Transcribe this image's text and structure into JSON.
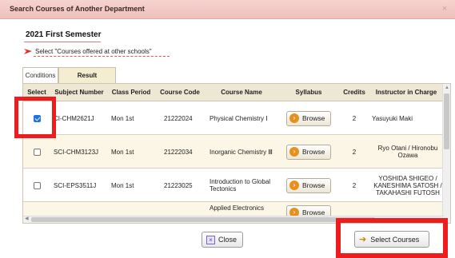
{
  "window": {
    "title": "Search Courses of Another Department",
    "close_glyph": "×"
  },
  "semester": "2021 First Semester",
  "instruction": "Select \"Courses offered at other schools\"",
  "tabs": [
    {
      "label": "Conditions"
    },
    {
      "label": "Result",
      "active": true
    }
  ],
  "table": {
    "headers": [
      "Select",
      "Subject Number",
      "Class Period",
      "Course Code",
      "Course Name",
      "Syllabus",
      "Credits",
      "Instructor in Charge"
    ],
    "rows": [
      {
        "checked": true,
        "subject_number": "CI-CHM2621J",
        "class_period": "Mon 1st",
        "course_code": "21222024",
        "course_name": "Physical Chemistry Ⅰ",
        "syllabus": "Browse",
        "credits": "2",
        "instructor": "Yasuyuki Maki"
      },
      {
        "checked": false,
        "subject_number": "SCI-CHM3123J",
        "class_period": "Mon 1st",
        "course_code": "21222034",
        "course_name": "Inorganic Chemistry Ⅲ",
        "syllabus": "Browse",
        "credits": "2",
        "instructor": "Ryo Otani / Hironobu Ozawa"
      },
      {
        "checked": false,
        "subject_number": "SCI-EPS3511J",
        "class_period": "Mon 1st",
        "course_code": "21223025",
        "course_name": "Introduction to Global Tectonics",
        "syllabus": "Browse",
        "credits": "2",
        "instructor": "YOSHIDA SHIGEO / KANESHIMA SATOSH / TAKAHASHI FUTOSH"
      },
      {
        "checked": false,
        "subject_number": "",
        "class_period": "",
        "course_code": "",
        "course_name": "Applied Electronics",
        "syllabus": "Browse",
        "credits": "",
        "instructor": ""
      }
    ]
  },
  "buttons": {
    "close": "Close",
    "select": "Select Courses"
  },
  "colors": {
    "highlight": "#ee1c1c",
    "titlebar": "#f2c6c2",
    "browse_icon": "#e8901e",
    "checked": "#1a73e8"
  }
}
